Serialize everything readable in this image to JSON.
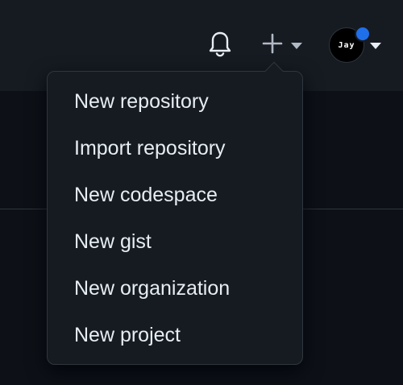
{
  "header": {
    "notifications_icon": "bell-icon",
    "create_icon": "plus-icon",
    "create_caret_icon": "caret-down-icon",
    "avatar": {
      "initials": "Jay",
      "status_color": "#1f6feb",
      "caret_icon": "caret-down-icon"
    }
  },
  "create_menu": {
    "items": [
      {
        "label": "New repository"
      },
      {
        "label": "Import repository"
      },
      {
        "label": "New codespace"
      },
      {
        "label": "New gist"
      },
      {
        "label": "New organization"
      },
      {
        "label": "New project"
      }
    ]
  },
  "colors": {
    "background": "#0d1117",
    "header_bg": "#161b22",
    "menu_bg": "#161b22",
    "border": "#30363d",
    "text": "#e6edf3",
    "icon": "#e6edf3",
    "accent": "#1f6feb"
  }
}
